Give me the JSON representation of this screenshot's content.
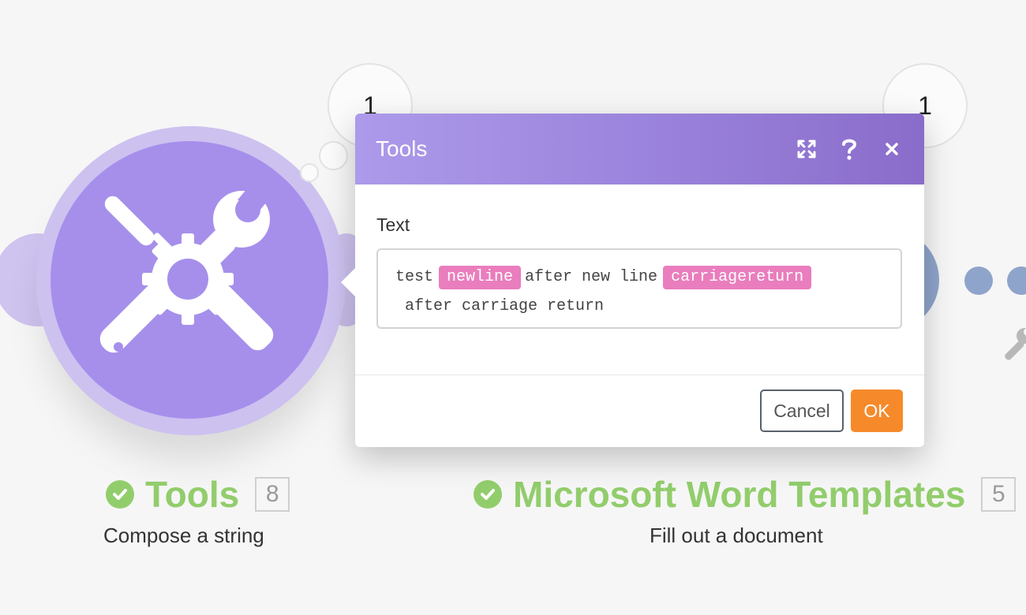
{
  "dialog": {
    "title": "Tools",
    "field_label": "Text",
    "tokens": [
      {
        "type": "text",
        "value": "test"
      },
      {
        "type": "pill",
        "value": "newline"
      },
      {
        "type": "text",
        "value": "after new line"
      },
      {
        "type": "pill",
        "value": "carriagereturn"
      },
      {
        "type": "text",
        "value": "after carriage return"
      }
    ],
    "cancel_label": "Cancel",
    "ok_label": "OK",
    "header_icons": [
      "expand-icon",
      "help-icon",
      "close-icon"
    ]
  },
  "bubbles": {
    "left_count": "1",
    "right_count": "1"
  },
  "modules": {
    "tools": {
      "title": "Tools",
      "count": "8",
      "subtitle": "Compose a string",
      "icon": "tools-icon"
    },
    "word": {
      "title": "Microsoft Word Templates",
      "count": "5",
      "subtitle": "Fill out a document"
    }
  },
  "colors": {
    "tools_module": "#a68feb",
    "header_gradient_start": "#ad9aea",
    "header_gradient_end": "#8a6cca",
    "pill": "#ea7dbd",
    "ok_button": "#f68a2b",
    "success_green": "#92cd6c",
    "word_module": "#8fa4cb"
  }
}
